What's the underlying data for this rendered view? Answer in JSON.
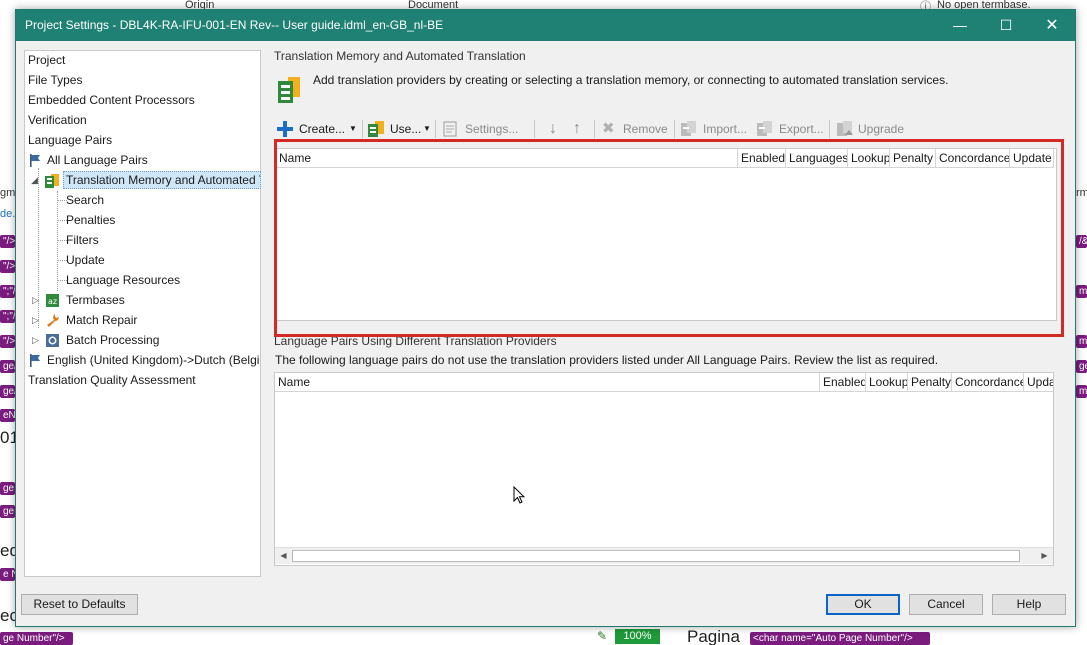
{
  "background": {
    "col_origin": "Origin",
    "col_document": "Document",
    "termbase_status": "No open termbase.",
    "frag_gme": "gme",
    "frag_rm": "rm",
    "frag_de": "de.",
    "frag_num": "01",
    "frag_ed": "ed",
    "frag_ec": "ec",
    "tags_left": [
      "\"/>",
      "\"/>",
      "\";\"/>",
      "\";\"/>",
      "\"/>",
      "ge/&",
      "ge/&",
      "eN",
      "ge",
      "ge",
      "e N",
      "ge Number\"/>"
    ],
    "tags_right": [
      "/&",
      "m/",
      "m/",
      "ge",
      "m/"
    ],
    "zoom": "100%",
    "pagina": "Pagina",
    "char_tag": "<char name=\"Auto Page Number\"/>"
  },
  "dialog": {
    "title": "Project Settings - DBL4K-RA-IFU-001-EN Rev-- User guide.idml_en-GB_nl-BE",
    "window_buttons": {
      "minimize": "—",
      "maximize": "☐",
      "close": "✕"
    },
    "tree": [
      {
        "label": "Project"
      },
      {
        "label": "File Types"
      },
      {
        "label": "Embedded Content Processors"
      },
      {
        "label": "Verification"
      },
      {
        "label": "Language Pairs"
      },
      {
        "label": "All Language Pairs"
      },
      {
        "label": "Translation Memory and Automated Translation"
      },
      {
        "label": "Search"
      },
      {
        "label": "Penalties"
      },
      {
        "label": "Filters"
      },
      {
        "label": "Update"
      },
      {
        "label": "Language Resources"
      },
      {
        "label": "Termbases"
      },
      {
        "label": "Match Repair"
      },
      {
        "label": "Batch Processing"
      },
      {
        "label": "English (United Kingdom)->Dutch (Belgium)"
      },
      {
        "label": "Translation Quality Assessment"
      }
    ],
    "tm_section": {
      "title": "Translation Memory and Automated Translation",
      "description": "Add translation providers by creating or selecting a translation memory, or connecting to automated translation services.",
      "toolbar": {
        "create": "Create...",
        "use": "Use...",
        "settings": "Settings...",
        "remove": "Remove",
        "import": "Import...",
        "export": "Export...",
        "upgrade": "Upgrade"
      },
      "columns": [
        "Name",
        "Enabled",
        "Languages",
        "Lookup",
        "Penalty",
        "Concordance",
        "Update"
      ]
    },
    "lp_section": {
      "title": "Language Pairs Using Different Translation Providers",
      "description": "The following language pairs do not use the translation providers listed under All Language Pairs. Review the list as required.",
      "columns": [
        "Name",
        "Enabled",
        "Lookup",
        "Penalty",
        "Concordance",
        "Update"
      ]
    },
    "buttons": {
      "reset": "Reset to Defaults",
      "ok": "OK",
      "cancel": "Cancel",
      "help": "Help"
    }
  }
}
